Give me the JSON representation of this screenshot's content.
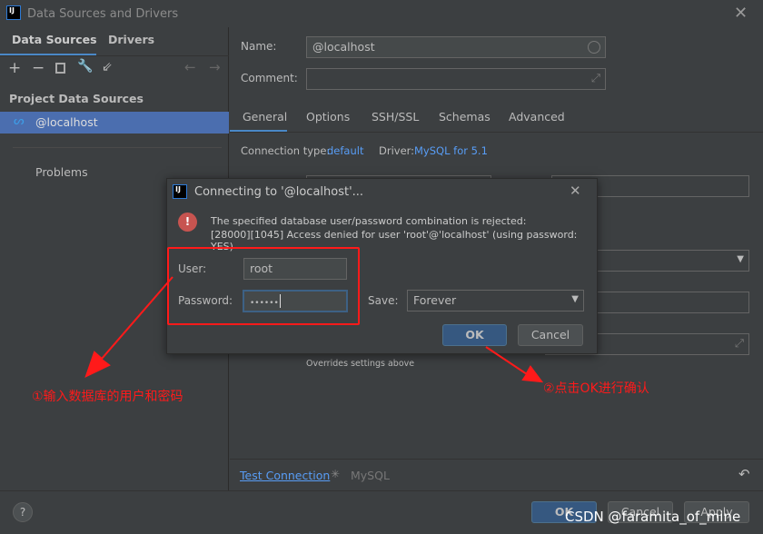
{
  "window": {
    "title": "Data Sources and Drivers",
    "app_icon": "intellij-icon"
  },
  "left": {
    "tabs": [
      {
        "label": "Data Sources",
        "active": true
      },
      {
        "label": "Drivers",
        "active": false
      }
    ],
    "section": "Project Data Sources",
    "selected_item": "@localhost",
    "problems": "Problems"
  },
  "right": {
    "name_label": "Name:",
    "name_value": "@localhost",
    "comment_label": "Comment:",
    "comment_value": "",
    "tabs": [
      "General",
      "Options",
      "SSH/SSL",
      "Schemas",
      "Advanced"
    ],
    "active_tab": "General",
    "conn_type_label": "Connection type:",
    "conn_type_value": "default",
    "driver_label": "Driver:",
    "driver_value": "MySQL for 5.1",
    "overrides": "Overrides settings above",
    "test_connection": "Test Connection",
    "status": "MySQL"
  },
  "footer": {
    "help": "?",
    "ok": "OK",
    "cancel": "Cancel",
    "apply": "Apply"
  },
  "dialog": {
    "title": "Connecting to '@localhost'...",
    "error_line1": "The specified database user/password combination is rejected:",
    "error_line2": "[28000][1045] Access denied for user 'root'@'localhost' (using password: YES)",
    "user_label": "User:",
    "user_value": "root",
    "password_label": "Password:",
    "password_value": "••••••",
    "save_label": "Save:",
    "save_value": "Forever",
    "ok": "OK",
    "cancel": "Cancel"
  },
  "annotations": {
    "note1": "①输入数据库的用户和密码",
    "note2": "②点击OK进行确认",
    "color": "#ff1a1a"
  },
  "watermark": "CSDN @faramita_of_mine"
}
